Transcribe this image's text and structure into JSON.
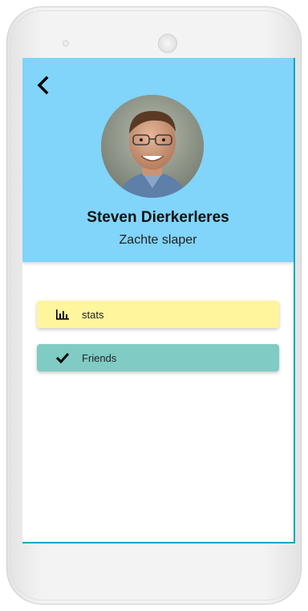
{
  "profile": {
    "name": "Steven Dierkerleres",
    "subtitle": "Zachte slaper"
  },
  "menu": {
    "items": [
      {
        "label": "stats",
        "icon": "bar-chart-icon",
        "color": "#fff59d"
      },
      {
        "label": "Friends",
        "icon": "check-icon",
        "color": "#80cbc4"
      }
    ]
  },
  "colors": {
    "header": "#81d4fa",
    "accent_border": "#00a6c4"
  },
  "icons": {
    "back": "chevron-left-icon"
  }
}
